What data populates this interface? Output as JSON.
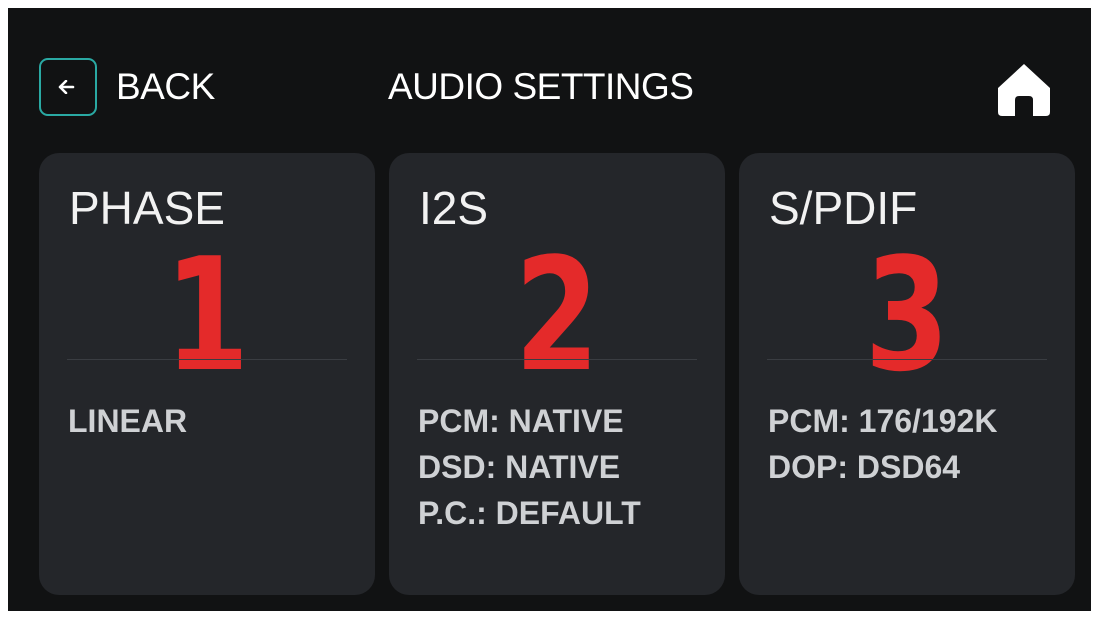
{
  "header": {
    "back_label": "BACK",
    "title": "AUDIO SETTINGS",
    "back_icon": "arrow-left-icon",
    "home_icon": "home-icon"
  },
  "colors": {
    "background": "#111213",
    "card": "#24262a",
    "accent_teal": "#2aa9a3",
    "number_red": "#e42a2a",
    "text_white": "#ffffff",
    "text_muted": "#cfd1d4"
  },
  "cards": [
    {
      "title": "PHASE",
      "number": "1",
      "lines": [
        "LINEAR"
      ]
    },
    {
      "title": "I2S",
      "number": "2",
      "lines": [
        "PCM: NATIVE",
        "DSD: NATIVE",
        "P.C.: DEFAULT"
      ]
    },
    {
      "title": "S/PDIF",
      "number": "3",
      "lines": [
        "PCM: 176/192K",
        "DOP: DSD64"
      ]
    }
  ]
}
